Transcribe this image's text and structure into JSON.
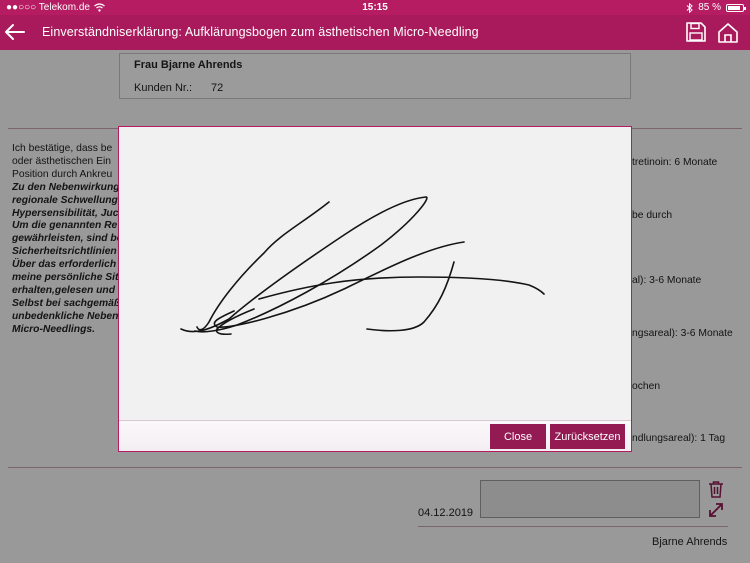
{
  "status_bar": {
    "carrier": "●●○○○ Telekom.de",
    "time": "15:15",
    "battery": "85 %",
    "icons": [
      "wifi-icon",
      "bluetooth-icon",
      "battery-icon"
    ]
  },
  "header": {
    "title": "Einverständniserklärung: Aufklärungsbogen zum ästhetischen Micro-Needling",
    "icons": [
      "back-arrow-icon",
      "save-icon",
      "home-icon"
    ]
  },
  "customer": {
    "name": "Frau Bjarne Ahrends",
    "number_label": "Kunden Nr.:",
    "number_value": "72"
  },
  "consent_lines": [
    {
      "text": "Ich bestätige, dass be",
      "style": "normal"
    },
    {
      "text": "oder ästhetischen Ein",
      "style": "normal"
    },
    {
      "text": "Position durch Ankreu",
      "style": "normal"
    },
    {
      "text": "Zu den Nebenwirkung",
      "style": "bold-italic"
    },
    {
      "text": "regionale Schwellung",
      "style": "bold-italic"
    },
    {
      "text": "Hypersensibilität, Juc",
      "style": "bold-italic"
    },
    {
      "text": "Um die genannten Re",
      "style": "bold-italic"
    },
    {
      "text": "gewährleisten, sind be",
      "style": "bold-italic"
    },
    {
      "text": "Sicherheitsrichtlinien",
      "style": "bold-italic"
    },
    {
      "text": "Über das erforderlich",
      "style": "bold-italic"
    },
    {
      "text": "meine persönliche Sit",
      "style": "bold-italic"
    },
    {
      "text": "erhalten,gelesen und",
      "style": "bold-italic"
    },
    {
      "text": "Selbst bei sachgemäß",
      "style": "bold-italic"
    },
    {
      "text": "unbedenkliche Neben",
      "style": "bold-italic"
    },
    {
      "text": "Micro-Needlings.",
      "style": "bold-italic"
    }
  ],
  "side_fragments": [
    "tretinoin: 6 Monate",
    "be durch",
    "al): 3-6 Monate",
    "ngsareal): 3-6 Monate",
    "ochen",
    "ndlungsareal): 1 Tag"
  ],
  "signature": {
    "date": "04.12.2019",
    "signer_name": "Bjarne Ahrends",
    "icons": [
      "trash-icon",
      "expand-icon"
    ]
  },
  "modal": {
    "close_label": "Close",
    "reset_label": "Zurücksetzen"
  },
  "colors": {
    "primary": "#a81a5c",
    "status_bar": "#b51c62",
    "button": "#931a52"
  }
}
